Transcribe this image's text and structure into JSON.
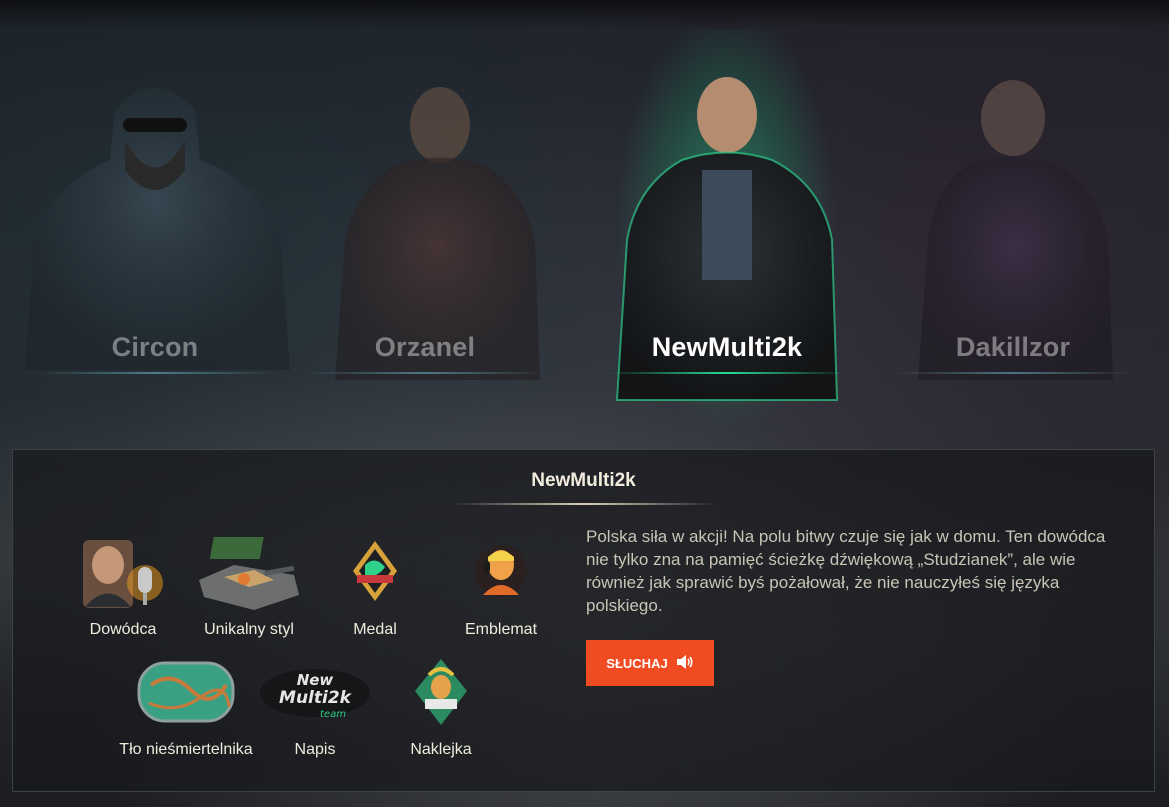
{
  "commanders": [
    {
      "name": "Circon",
      "active": false
    },
    {
      "name": "Orzanel",
      "active": false
    },
    {
      "name": "NewMulti2k",
      "active": true
    },
    {
      "name": "Dakillzor",
      "active": false
    }
  ],
  "panel": {
    "title": "NewMulti2k",
    "rewards": [
      {
        "label": "Dowódca",
        "icon": "commander-portrait-icon"
      },
      {
        "label": "Unikalny styl",
        "icon": "tank-style-icon"
      },
      {
        "label": "Medal",
        "icon": "medal-icon"
      },
      {
        "label": "Emblemat",
        "icon": "emblem-icon"
      },
      {
        "label": "Tło nieśmiertelnika",
        "icon": "dogtag-background-icon"
      },
      {
        "label": "Napis",
        "icon": "inscription-icon"
      },
      {
        "label": "Naklejka",
        "icon": "sticker-icon"
      }
    ],
    "description": "Polska siła w akcji! Na polu bitwy czuje się jak w domu. Ten dowódca nie tylko zna na pamięć ścieżkę dźwiękową „Studzianek”, ale wie również jak sprawić byś pożałował, że nie nauczyłeś się języka polskiego.",
    "listen_button": "SŁUCHAJ",
    "listen_icon": "speaker-icon"
  },
  "colors": {
    "accent": "#f04b21",
    "active_glow": "#1edc8c"
  }
}
